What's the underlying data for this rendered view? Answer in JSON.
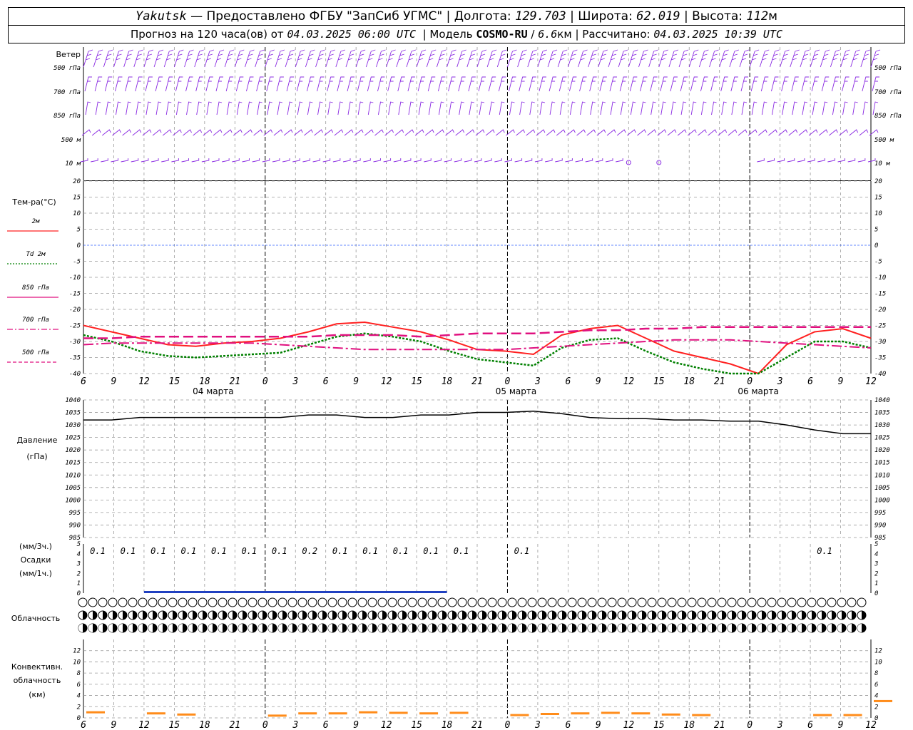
{
  "header": {
    "station": "Yakutsk",
    "provider": "— Предоставлено ФГБУ \"ЗапСиб УГМС\"",
    "lon_label": "Долгота:",
    "lon_value": "129.703",
    "lat_label": "Широта:",
    "lat_value": "62.019",
    "alt_label": "Высота:",
    "alt_value": "112",
    "alt_unit": "м",
    "forecast_prefix": "Прогноз на 120 часа(ов) от",
    "forecast_start": "04.03.2025 06:00 UTC",
    "model_label": "Модель",
    "model_name": "COSMO-RU",
    "model_res": "6.6",
    "model_res_unit": "км",
    "calc_label": "Рассчитано:",
    "calc_time": "04.03.2025 10:39 UTC"
  },
  "panels": {
    "wind": {
      "title": "Ветер",
      "levels": [
        "500 гПа",
        "700 гПа",
        "850 гПа",
        "500 м",
        "10  м"
      ]
    },
    "temp": {
      "title": "Тем-ра(°C)",
      "legend": [
        {
          "label": "2м",
          "color": "#ff2020",
          "dash": "solid"
        },
        {
          "label": "Td  2м",
          "color": "#008000",
          "dash": "dotted"
        },
        {
          "label": "850 гПа",
          "color": "#e0107f",
          "dash": "solid"
        },
        {
          "label": "700 гПа",
          "color": "#e0107f",
          "dash": "dashdot"
        },
        {
          "label": "500 гПа",
          "color": "#e0107f",
          "dash": "dashed"
        }
      ]
    },
    "pressure": {
      "title": "Давление",
      "unit": "(гПа)"
    },
    "precip": {
      "unit3": "(мм/3ч.)",
      "title": "Осадки",
      "unit1": "(мм/1ч.)"
    },
    "cloud": {
      "title": "Облачность"
    },
    "conv": {
      "title1": "Конвективн.",
      "title2": "облачность",
      "unit": "(км)"
    }
  },
  "x_hour_labels": [
    "6",
    "9",
    "12",
    "15",
    "18",
    "21",
    "0",
    "3",
    "6",
    "9",
    "12",
    "15",
    "18",
    "21",
    "0",
    "3",
    "6",
    "9",
    "12",
    "15",
    "18",
    "21",
    "0",
    "3",
    "6",
    "9",
    "12"
  ],
  "date_labels": [
    "04 марта",
    "05 марта",
    "06 марта"
  ],
  "chart_data": [
    {
      "type": "line",
      "title": "Тем-ра(°C)",
      "x_hours_from_start": [
        0,
        3,
        6,
        9,
        12,
        15,
        18,
        21,
        24,
        27,
        30,
        33,
        36,
        39,
        42,
        45,
        48,
        51,
        54,
        57,
        60,
        63,
        66,
        69,
        72,
        75,
        78
      ],
      "ylim": [
        -40,
        20
      ],
      "y_ticks": [
        20,
        15,
        10,
        5,
        0,
        -5,
        -10,
        -15,
        -20,
        -25,
        -30,
        -35,
        -40
      ],
      "series": [
        {
          "name": "2м",
          "color": "#ff2020",
          "values": [
            -25,
            -27,
            -29,
            -31,
            -31.5,
            -30.5,
            -30,
            -29,
            -27,
            -24.5,
            -24,
            -25.5,
            -27,
            -29.5,
            -32.5,
            -33,
            -34,
            -28,
            -26,
            -25,
            -29,
            -33,
            -35,
            -37,
            -40,
            -31,
            -27,
            -26,
            -29
          ]
        },
        {
          "name": "Td  2м",
          "color": "#008000",
          "values": [
            -28,
            -30,
            -33,
            -34.5,
            -35,
            -34.5,
            -34,
            -33.5,
            -31,
            -28.5,
            -27.5,
            -28.5,
            -30,
            -33,
            -35.5,
            -36.5,
            -37.5,
            -32,
            -29.5,
            -29,
            -33,
            -36.5,
            -38.5,
            -40,
            -44,
            -35,
            -30,
            -30,
            -32
          ]
        },
        {
          "name": "850 гПа",
          "color": "#e0107f",
          "values": [
            -29,
            -29,
            -28.5,
            -28.5,
            -28.5,
            -28.5,
            -28.5,
            -28.5,
            -28.5,
            -28,
            -28,
            -28,
            -28.5,
            -28,
            -27.5,
            -27.5,
            -27.5,
            -27,
            -26.5,
            -26.5,
            -26,
            -26,
            -25.5,
            -25.5,
            -25.5,
            -25.5,
            -25.5,
            -25.5,
            -25.5
          ]
        },
        {
          "name": "700 гПа",
          "color": "#e0107f",
          "values": [
            -31,
            -30.5,
            -30.5,
            -30.5,
            -30.5,
            -30.5,
            -30.5,
            -31,
            -31.5,
            -32,
            -32.5,
            -32.5,
            -32.5,
            -32.5,
            -32.5,
            -32.5,
            -32,
            -31.5,
            -31,
            -30.5,
            -30,
            -29.5,
            -29.5,
            -29.5,
            -30,
            -30.5,
            -31,
            -31.5,
            -32
          ]
        }
      ]
    },
    {
      "type": "line",
      "title": "Давление",
      "ylabel": "(гПа)",
      "ylim": [
        985,
        1040
      ],
      "y_ticks": [
        1040,
        1035,
        1030,
        1025,
        1020,
        1015,
        1010,
        1005,
        1000,
        995,
        990,
        985
      ],
      "series": [
        {
          "name": "Давление",
          "color": "#000000",
          "x_hours_from_start": [
            0,
            3,
            6,
            9,
            12,
            15,
            18,
            21,
            24,
            27,
            30,
            33,
            36,
            39,
            42,
            45,
            48,
            51,
            54,
            57,
            60,
            63,
            66,
            69,
            72,
            75,
            78
          ],
          "values": [
            1032,
            1032,
            1033,
            1033,
            1033,
            1033,
            1033,
            1033,
            1034,
            1034,
            1033,
            1033,
            1034,
            1034,
            1035,
            1035,
            1035.5,
            1034.5,
            1033,
            1032.5,
            1032.5,
            1032,
            1032,
            1031.5,
            1031.5,
            1030,
            1028,
            1026.5,
            1026.5
          ]
        }
      ]
    },
    {
      "type": "bar",
      "title": "Осадки",
      "ylabel": "(мм/3ч.)",
      "ylim": [
        0,
        5
      ],
      "y_ticks": [
        5,
        4,
        3,
        2,
        1,
        0
      ],
      "labels": [
        "0.1",
        "0.1",
        "0.1",
        "0.1",
        "0.1",
        "0.1",
        "0.1",
        "0.2",
        "0.1",
        "0.1",
        "0.1",
        "0.1",
        "0.1",
        "",
        "0.1",
        "",
        "",
        "",
        "",
        "",
        "",
        "",
        "",
        "",
        "0.1",
        "",
        ""
      ]
    },
    {
      "type": "bar",
      "title": "Конвективн. облачность",
      "ylabel": "(км)",
      "ylim": [
        0,
        14
      ],
      "y_ticks": [
        12,
        10,
        8,
        6,
        4,
        2,
        0
      ],
      "values": [
        1,
        0,
        0.8,
        0.6,
        0,
        0,
        0.4,
        0.8,
        0.8,
        1,
        0.9,
        0.8,
        0.9,
        0,
        0.5,
        0.7,
        0.8,
        0.9,
        0.8,
        0.6,
        0.5,
        0,
        0,
        0,
        0.5,
        0.5,
        3,
        0
      ]
    }
  ]
}
